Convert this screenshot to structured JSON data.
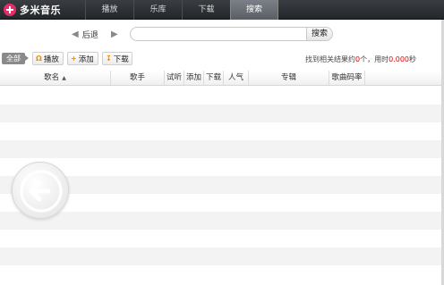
{
  "app": {
    "title": "多米音乐"
  },
  "tabs": [
    {
      "label": "播放",
      "active": false
    },
    {
      "label": "乐库",
      "active": false
    },
    {
      "label": "下载",
      "active": false
    },
    {
      "label": "搜索",
      "active": true
    }
  ],
  "search": {
    "back_label": "后退",
    "forward_label": "",
    "query": "",
    "placeholder": "",
    "button_label": "搜索"
  },
  "toolbar": {
    "all_label": "全部",
    "play_label": "播放",
    "add_label": "添加",
    "download_label": "下载",
    "result_prefix": "找到相关结果约",
    "result_count": "0",
    "result_mid": "个，用时",
    "result_time": "0.000",
    "result_suffix": "秒"
  },
  "table": {
    "columns": [
      "歌名",
      "歌手",
      "试听",
      "添加",
      "下载",
      "人气",
      "专辑",
      "歌曲码率"
    ],
    "rows": []
  },
  "icons": {
    "logo": "domi-logo-icon",
    "back": "arrow-left-icon",
    "forward": "arrow-right-icon",
    "play": "headphones-icon",
    "add": "plus-icon",
    "download": "download-icon",
    "sort": "sort-up-icon",
    "back_bubble": "circle-back-arrow-icon"
  },
  "colors": {
    "topbar": "#2b2e33",
    "active_tab": "#6b7077",
    "brand": "#e0306a",
    "accent_red": "#e00000",
    "row_alt": "#f3f3f3"
  }
}
